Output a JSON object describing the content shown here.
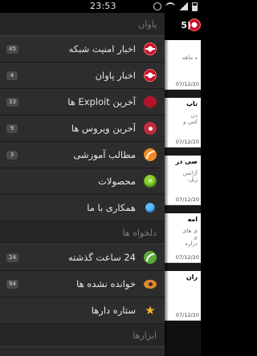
{
  "status_bar": {
    "time": "23:53"
  },
  "drawer": {
    "section_main": "پاوان",
    "section_downloads": "دلخواه ها",
    "section_tools": "ابزارها",
    "items": [
      {
        "label": "اخبار امنیت شبکه",
        "badge": "45",
        "icon": "paavan-logo-icon"
      },
      {
        "label": "اخبار پاوان",
        "badge": "4",
        "icon": "paavan-logo-icon"
      },
      {
        "label": "آخرین Exploit ها",
        "badge": "33",
        "icon": "shield-icon"
      },
      {
        "label": "آخرین ویروس ها",
        "badge": "9",
        "icon": "virus-icon"
      },
      {
        "label": "مطالب آموزشی",
        "badge": "3",
        "icon": "rss-icon"
      },
      {
        "label": "محصولات",
        "badge": "",
        "icon": "product-icon"
      },
      {
        "label": "همکاری با ما",
        "badge": "",
        "icon": "globe-icon"
      }
    ],
    "fav_items": [
      {
        "label": "24 ساعت گذشته",
        "badge": "24",
        "icon": "rss-green-icon"
      },
      {
        "label": "خوانده نشده ها",
        "badge": "94",
        "icon": "eye-icon"
      },
      {
        "label": "ستاره دارها",
        "badge": "",
        "icon": "star-icon"
      }
    ]
  },
  "content": {
    "header_title": "(5",
    "tiles": [
      {
        "title": "",
        "text": "ه ماهه",
        "date": "07/12/20"
      },
      {
        "title": "تاپ",
        "text": "دن\nکس و",
        "date": "07/12/20"
      },
      {
        "title": "صی در",
        "text": "آژانس\nزیل،",
        "date": "07/12/20"
      },
      {
        "title": "امه",
        "text": "ی های\nی\nدراره",
        "date": "07/12/20"
      },
      {
        "title": "ران",
        "text": "",
        "date": "07/12/20"
      }
    ]
  }
}
